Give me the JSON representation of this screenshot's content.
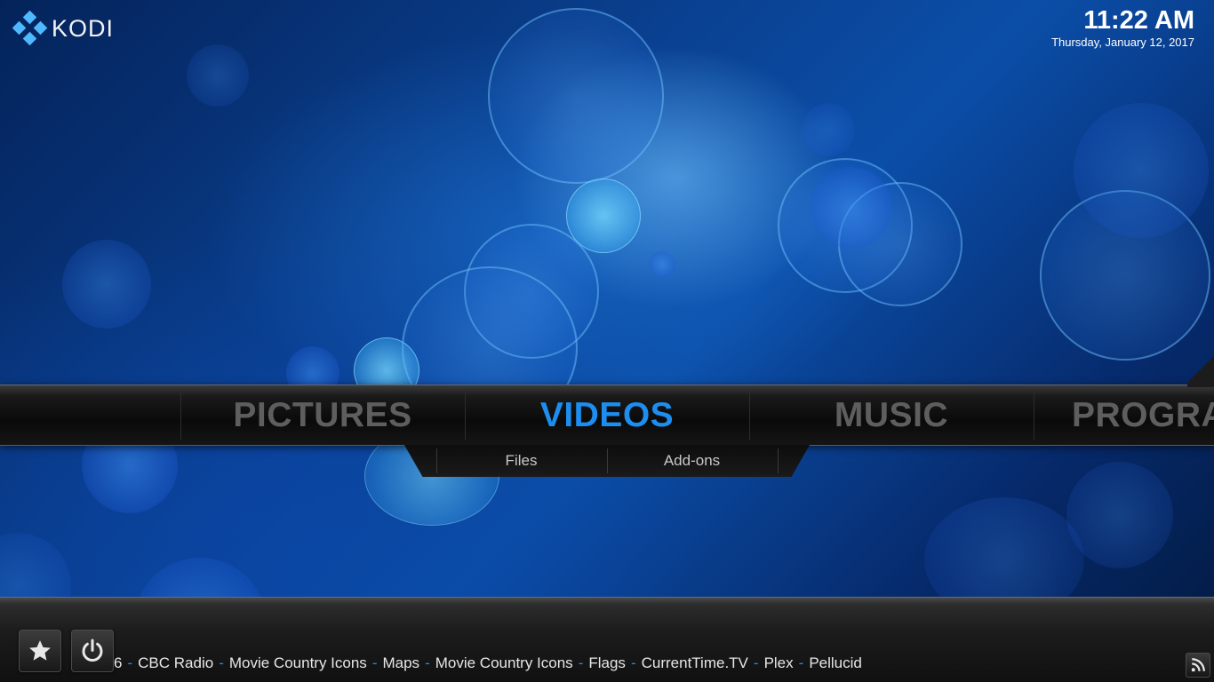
{
  "app": {
    "logo_text": "KODI",
    "logo_color": "#4fb8ff"
  },
  "clock": {
    "time": "11:22 AM",
    "date": "Thursday, January 12, 2017"
  },
  "main_menu": {
    "items": [
      {
        "label": "PICTURES",
        "active": false
      },
      {
        "label": "VIDEOS",
        "active": true
      },
      {
        "label": "MUSIC",
        "active": false
      },
      {
        "label": "PROGRA",
        "active": false
      }
    ],
    "active_color": "#1d8ef0",
    "inactive_color": "#5e5e5e"
  },
  "submenu": {
    "items": [
      "Files",
      "Add-ons"
    ]
  },
  "bottom_bar": {
    "favourites_icon": "star-icon",
    "power_icon": "power-icon",
    "rss_icon": "rss-icon",
    "ticker": [
      "6",
      "CBC Radio",
      "Movie Country Icons",
      "Maps",
      "Movie Country Icons",
      "Flags",
      "CurrentTime.TV",
      "Plex",
      "Pellucid"
    ],
    "ticker_separator": "-",
    "separator_color": "#2a8ae6"
  }
}
